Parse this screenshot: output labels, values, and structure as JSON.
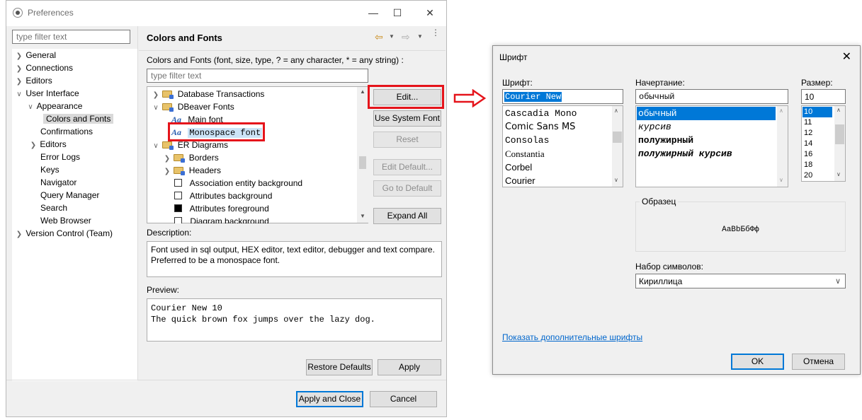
{
  "preferences": {
    "title": "Preferences",
    "filter_placeholder": "type filter text",
    "tree": [
      {
        "label": "General",
        "expanded": false
      },
      {
        "label": "Connections",
        "expanded": false
      },
      {
        "label": "Editors",
        "expanded": false
      },
      {
        "label": "User Interface",
        "expanded": true
      },
      {
        "label": "Appearance",
        "expanded": true
      },
      {
        "label": "Colors and Fonts",
        "selected": true
      },
      {
        "label": "Confirmations"
      },
      {
        "label": "Editors",
        "expanded": false
      },
      {
        "label": "Error Logs"
      },
      {
        "label": "Keys"
      },
      {
        "label": "Navigator"
      },
      {
        "label": "Query Manager"
      },
      {
        "label": "Search"
      },
      {
        "label": "Web Browser"
      },
      {
        "label": "Version Control (Team)",
        "expanded": false
      }
    ],
    "page_title": "Colors and Fonts",
    "page_description": "Colors and Fonts (font, size, type, ? = any character, * = any string) :",
    "page_filter_placeholder": "type filter text",
    "font_tree": [
      {
        "label": "Database Transactions",
        "kind": "folder",
        "chevron": "right"
      },
      {
        "label": "DBeaver Fonts",
        "kind": "folder",
        "chevron": "down"
      },
      {
        "label": "Main font",
        "kind": "font"
      },
      {
        "label": "Monospace font",
        "kind": "font",
        "selected": true
      },
      {
        "label": "ER Diagrams",
        "kind": "folder",
        "chevron": "down"
      },
      {
        "label": "Borders",
        "kind": "folder",
        "chevron": "right"
      },
      {
        "label": "Headers",
        "kind": "folder",
        "chevron": "right"
      },
      {
        "label": "Association entity background",
        "kind": "color",
        "swatch": "#ffffff"
      },
      {
        "label": "Attributes background",
        "kind": "color",
        "swatch": "#ffffff"
      },
      {
        "label": "Attributes foreground",
        "kind": "color",
        "swatch": "#000000"
      },
      {
        "label": "Diagram background",
        "kind": "color",
        "swatch": "#ffffff"
      }
    ],
    "buttons": {
      "edit": "Edit...",
      "use_system_font": "Use System Font",
      "reset": "Reset",
      "edit_default": "Edit Default...",
      "go_to_default": "Go to Default",
      "expand_all": "Expand All",
      "restore_defaults": "Restore Defaults",
      "apply": "Apply",
      "apply_and_close": "Apply and Close",
      "cancel": "Cancel"
    },
    "description_label": "Description:",
    "description_text": "Font used in sql output, HEX editor, text editor, debugger and text compare. Preferred to be a monospace font.",
    "preview_label": "Preview:",
    "preview_line1": "Courier New 10",
    "preview_line2": "The quick brown fox jumps over the lazy dog."
  },
  "font_dialog": {
    "title": "Шрифт",
    "font_label": "Шрифт:",
    "font_value": "Courier New",
    "fonts": [
      "Cascadia Mono",
      "Comic Sans MS",
      "Consolas",
      "Constantia",
      "Corbel",
      "Courier"
    ],
    "style_label": "Начертание:",
    "style_value": "обычный",
    "styles": [
      "обычный",
      "курсив",
      "полужирный",
      "полужирный курсив"
    ],
    "size_label": "Размер:",
    "size_value": "10",
    "sizes": [
      "10",
      "11",
      "12",
      "14",
      "16",
      "18",
      "20"
    ],
    "sample_label": "Образец",
    "sample_text": "AaBbБбФф",
    "charset_label": "Набор символов:",
    "charset_value": "Кириллица",
    "more_fonts_link": "Показать дополнительные шрифты",
    "ok": "OK",
    "cancel": "Отмена"
  },
  "colors": {
    "highlight": "#e5141b",
    "selection": "#0078d7",
    "link": "#0066cc"
  }
}
